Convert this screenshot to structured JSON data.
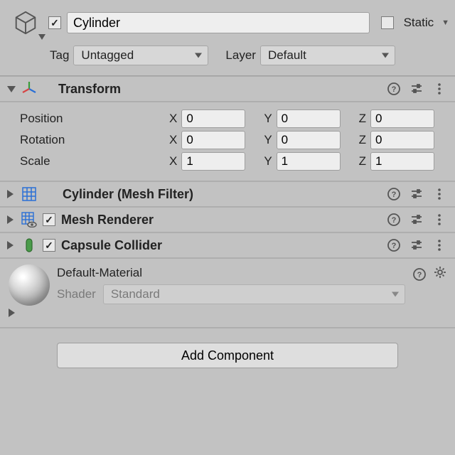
{
  "header": {
    "name": "Cylinder",
    "active": true,
    "static_label": "Static",
    "static_checked": false,
    "tag_label": "Tag",
    "tag_value": "Untagged",
    "layer_label": "Layer",
    "layer_value": "Default"
  },
  "transform": {
    "title": "Transform",
    "position_label": "Position",
    "rotation_label": "Rotation",
    "scale_label": "Scale",
    "axes": {
      "x": "X",
      "y": "Y",
      "z": "Z"
    },
    "position": {
      "x": "0",
      "y": "0",
      "z": "0"
    },
    "rotation": {
      "x": "0",
      "y": "0",
      "z": "0"
    },
    "scale": {
      "x": "1",
      "y": "1",
      "z": "1"
    }
  },
  "components": {
    "mesh_filter": "Cylinder (Mesh Filter)",
    "mesh_renderer": "Mesh Renderer",
    "capsule_collider": "Capsule Collider"
  },
  "material": {
    "name": "Default-Material",
    "shader_label": "Shader",
    "shader_value": "Standard"
  },
  "add_component": "Add Component"
}
